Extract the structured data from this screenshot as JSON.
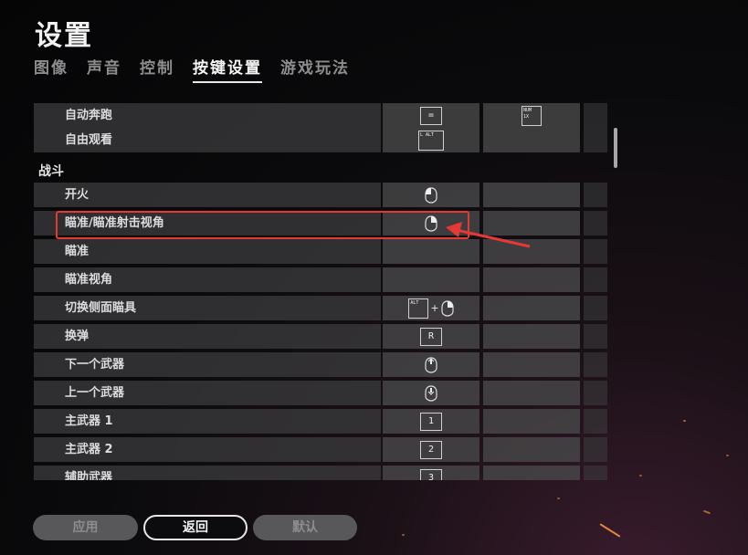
{
  "title": "设置",
  "tabs": [
    {
      "label": "图像",
      "active": false
    },
    {
      "label": "声音",
      "active": false
    },
    {
      "label": "控制",
      "active": false
    },
    {
      "label": "按键设置",
      "active": true
    },
    {
      "label": "游戏玩法",
      "active": false
    }
  ],
  "rows": {
    "auto_run": {
      "label": "自动奔跑",
      "key1": "=",
      "key2": "NUM\n1X"
    },
    "free_look": {
      "label": "自由观看",
      "key1": "L ALT"
    },
    "section_combat": "战斗",
    "fire": {
      "label": "开火",
      "key1_icon": "mouse-left-icon"
    },
    "aim_ads": {
      "label": "瞄准/瞄准射击视角",
      "key1_icon": "mouse-right-icon"
    },
    "aim": {
      "label": "瞄准"
    },
    "aim_view": {
      "label": "瞄准视角"
    },
    "toggle_canted": {
      "label": "切换侧面瞄具",
      "key1": "ALT",
      "plus": "+",
      "key1_icon": "mouse-right-icon"
    },
    "reload": {
      "label": "换弹",
      "key1": "R"
    },
    "next_weapon": {
      "label": "下一个武器",
      "key1_icon": "mouse-wheel-up-icon"
    },
    "prev_weapon": {
      "label": "上一个武器",
      "key1_icon": "mouse-wheel-down-icon"
    },
    "primary1": {
      "label": "主武器 1",
      "key1": "1"
    },
    "primary2": {
      "label": "主武器 2",
      "key1": "2"
    },
    "secondary": {
      "label": "辅助武器",
      "key1": "3"
    }
  },
  "buttons": {
    "apply": "应用",
    "back": "返回",
    "default": "默认"
  },
  "colors": {
    "highlight": "#e53935",
    "accent": "#ff9a3c"
  }
}
